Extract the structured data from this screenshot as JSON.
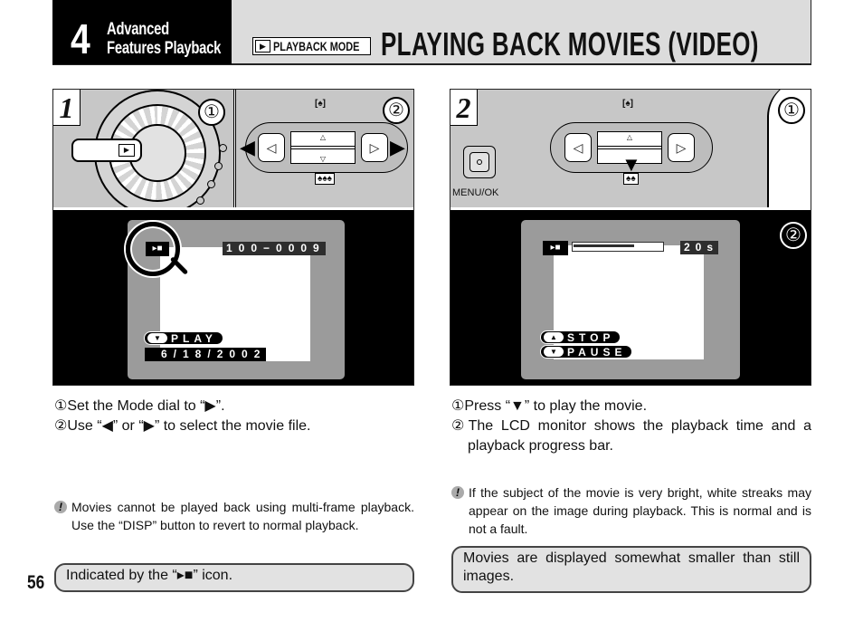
{
  "header": {
    "chapter_number": "4",
    "chapter_title_line1": "Advanced",
    "chapter_title_line2": "Features Playback",
    "mode_badge_icon": "play-icon",
    "mode_badge_glyph": "▶",
    "mode_badge_label": "PLAYBACK MODE",
    "page_title": "PLAYING BACK MOVIES (VIDEO)"
  },
  "step1": {
    "number": "1",
    "callout1": "①",
    "callout2": "②",
    "dial_mode_glyph": "▶",
    "left_arrow": "◀",
    "right_arrow": "▶",
    "left_button_glyph": "◁",
    "right_button_glyph": "▷",
    "tele_icon_label": "[♠]",
    "wide_icon_label": "♠♠♠",
    "lcd": {
      "movie_icon": "movie-camera-icon",
      "movie_glyph": "▸■",
      "file_number": "100−0009",
      "play_button_glyph": "▼",
      "play_label": "PLAY",
      "date": "6/18/2002"
    },
    "instructions": [
      "①Set the Mode dial to “▶”.",
      "②Use “◀” or “▶” to select the movie file."
    ],
    "note": "Movies cannot be played back using multi-frame playback. Use the “DISP” button to revert to normal playback.",
    "callout_box": "Indicated by the “▸■” icon."
  },
  "step2": {
    "number": "2",
    "callout1": "①",
    "callout2": "②",
    "menu_label": "MENU/OK",
    "down_arrow": "▼",
    "left_button_glyph": "◁",
    "right_button_glyph": "▷",
    "tele_icon_label": "[♠]",
    "wide_icon_label": "♠♠",
    "lcd": {
      "movie_icon": "movie-camera-icon",
      "movie_glyph": "▸■",
      "progress_fraction": 0.68,
      "time": "20s",
      "stop_button_glyph": "▲",
      "stop_label": "STOP",
      "pause_button_glyph": "▼",
      "pause_label": "PAUSE"
    },
    "instructions": [
      "①Press “▼” to play the movie.",
      "②The LCD monitor shows the playback time and a playback progress bar."
    ],
    "note": "If the subject of the movie is very bright, white streaks may appear on the image during playback. This is normal and is not a fault.",
    "callout_box": "Movies are displayed somewhat smaller than still images."
  },
  "footer": {
    "page_number": "56"
  }
}
